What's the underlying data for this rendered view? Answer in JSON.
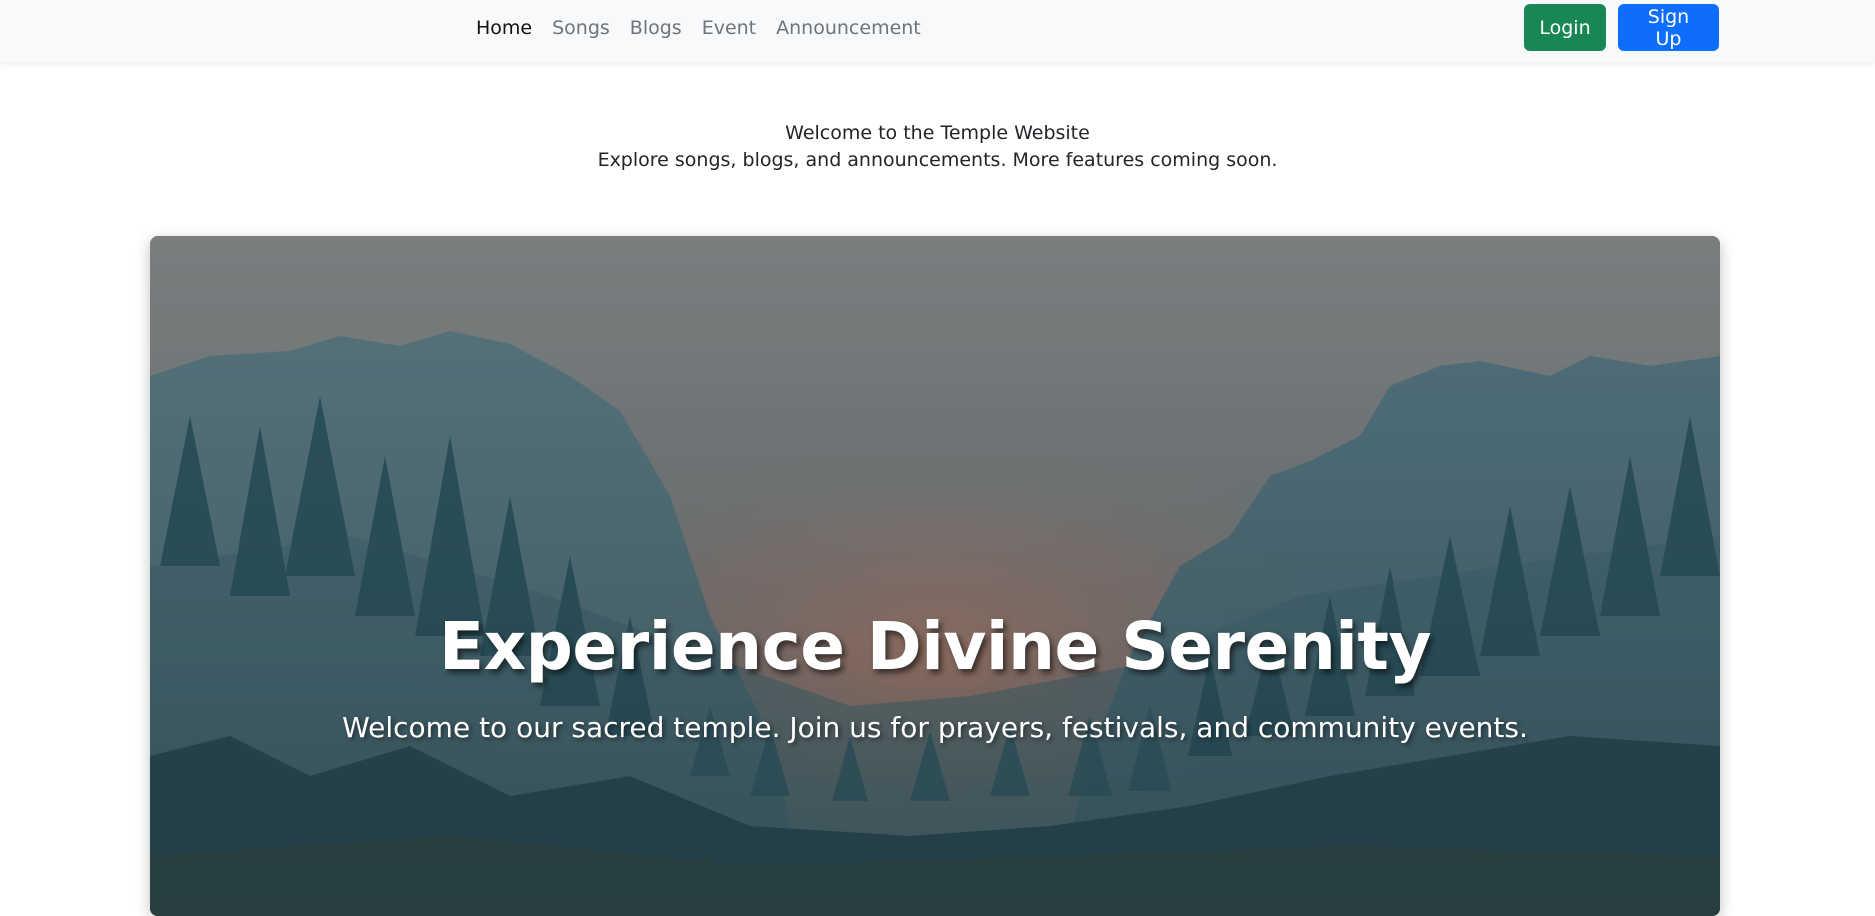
{
  "nav": {
    "links": [
      "Home",
      "Songs",
      "Blogs",
      "Event",
      "Announcement"
    ],
    "active": "Home"
  },
  "auth": {
    "login_label": "Login",
    "signup_label": "Sign Up"
  },
  "intro": {
    "title": "Welcome to the Temple Website",
    "subtitle": "Explore songs, blogs, and announcements. More features coming soon."
  },
  "hero": {
    "title": "Experience Divine Serenity",
    "subtitle": "Welcome to our sacred temple. Join us for prayers, festivals, and community events."
  },
  "colors": {
    "login": "#198754",
    "signup": "#0d6efd",
    "navbar_bg": "#f8f9fa"
  }
}
